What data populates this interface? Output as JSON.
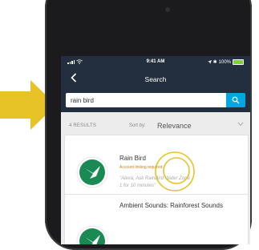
{
  "colors": {
    "header_bg": "#232f3e",
    "search_button": "#00a8e1",
    "skill_icon_green": "#1a8a55",
    "subtitle_orange": "#e47911",
    "pointer_arrow": "#e8c327",
    "battery_green": "#7ed321"
  },
  "status_bar": {
    "time": "9:41 AM",
    "battery": "100%",
    "battery_level": 1.0
  },
  "header": {
    "title": "Search",
    "back_icon": "chevron-left-icon"
  },
  "search": {
    "value": "rain bird",
    "button_icon": "search-icon"
  },
  "results": {
    "count_label": "4 RESULTS",
    "sort_label": "Sort by:",
    "sort_value": "Relevance"
  },
  "skills": [
    {
      "name": "Rain Bird",
      "subtitle": "Account linking required",
      "quote": "\"Alexa, Ask RainBird Water Zone 1 for 10 minutes\"",
      "icon": "bird-icon"
    },
    {
      "name": "Ambient Sounds: Rainforest Sounds",
      "icon": "bird-icon"
    }
  ]
}
